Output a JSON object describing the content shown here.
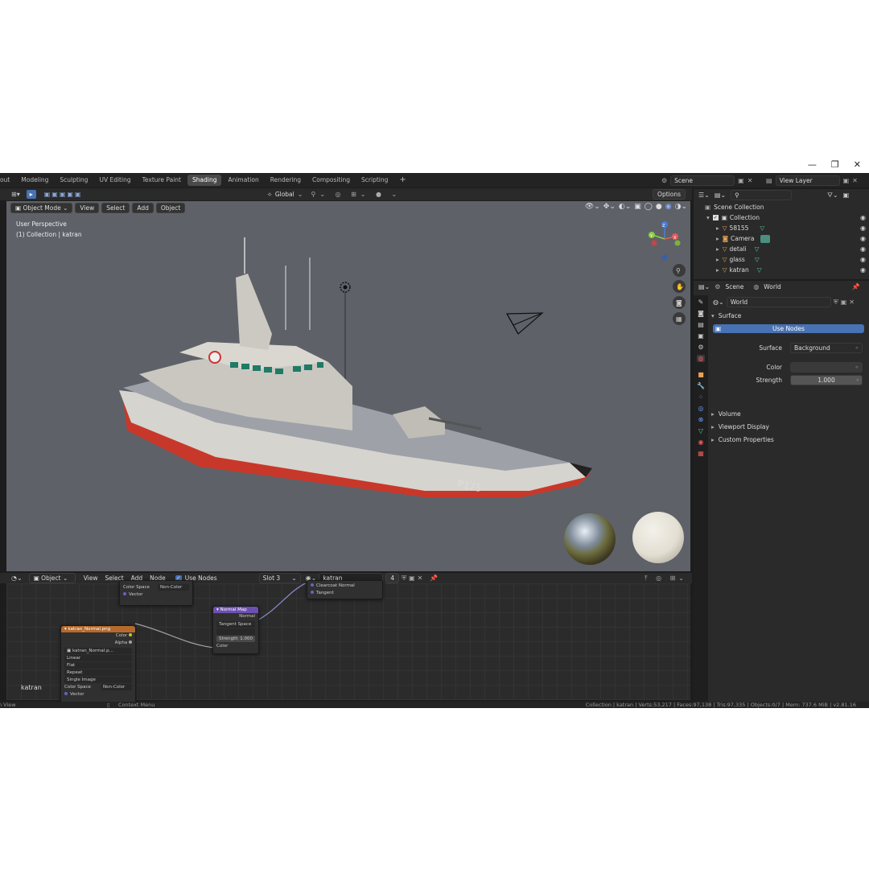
{
  "window": {
    "controls": [
      "—",
      "❐",
      "✕"
    ]
  },
  "topbar": {
    "tabs": [
      "out",
      "Modeling",
      "Sculpting",
      "UV Editing",
      "Texture Paint",
      "Shading",
      "Animation",
      "Rendering",
      "Compositing",
      "Scripting"
    ],
    "active_tab": "Shading",
    "add_tab": "+",
    "scene": "Scene",
    "view_layer": "View Layer"
  },
  "viewport_header": {
    "transform_orientation": "Global",
    "options": "Options"
  },
  "viewport_menu": {
    "mode": "Object Mode",
    "items": [
      "View",
      "Select",
      "Add",
      "Object"
    ]
  },
  "viewport_overlay": {
    "line1": "User Perspective",
    "line2": "(1) Collection | katran"
  },
  "gizmo": {
    "z": "Z",
    "y": "Y",
    "x": "X"
  },
  "hull_marking": "P175",
  "outliner": {
    "scene_collection": "Scene Collection",
    "collection": "Collection",
    "items": [
      "58155",
      "Camera",
      "detali",
      "glass",
      "katran"
    ]
  },
  "properties": {
    "breadcrumb_scene": "Scene",
    "breadcrumb_world": "World",
    "world_name": "World",
    "surface_panel": "Surface",
    "use_nodes_btn": "Use Nodes",
    "surface_label": "Surface",
    "surface_value": "Background",
    "color_label": "Color",
    "strength_label": "Strength",
    "strength_value": "1.000",
    "panels": [
      "Volume",
      "Viewport Display",
      "Custom Properties"
    ]
  },
  "node_header": {
    "object": "Object",
    "menu": [
      "View",
      "Select",
      "Add",
      "Node"
    ],
    "use_nodes": "Use Nodes",
    "slot": "Slot 3",
    "material": "katran",
    "users": "4"
  },
  "nodes": {
    "top_partial": {
      "color_space_label": "Color Space",
      "color_space_value": "Non-Color",
      "vector": "Vector"
    },
    "image_texture": {
      "title": "katran_Normal.png",
      "out_color": "Color",
      "out_alpha": "Alpha",
      "image": "katran_Normal.p...",
      "interp": "Linear",
      "projection": "Flat",
      "extension": "Repeat",
      "source": "Single Image",
      "color_space_label": "Color Space",
      "color_space_value": "Non-Color",
      "vector": "Vector"
    },
    "normal_map": {
      "title": "Normal Map",
      "out_normal": "Normal",
      "space": "Tangent Space",
      "strength_label": "Strength",
      "strength_value": "1.000",
      "in_color": "Color"
    },
    "bsdf_partial": {
      "row1": "Clearcoat Normal",
      "row2": "Tangent"
    },
    "material_label": "katran"
  },
  "status": {
    "left": "n View",
    "middle": "Context Menu",
    "right": "Collection | katran | Verts:53,217 | Faces:97,138 | Tris:97,335 | Objects:0/7 | Mem: 737.6 MiB | v2.81.16"
  },
  "colors": {
    "accent_blue": "#4772b3",
    "object_orange": "#e8a255",
    "mesh_green": "#4fd0a5"
  }
}
